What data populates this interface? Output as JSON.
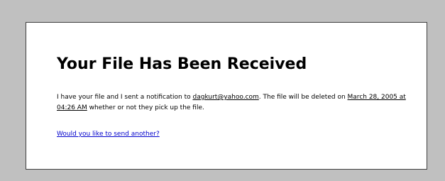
{
  "page": {
    "title": "Your File Has Been Received",
    "message": {
      "part1": "I have your file and I sent a notification to ",
      "email": "dagkurt@yahoo.com",
      "part2": ". The file will be deleted on ",
      "deletion_time": "March 28, 2005 at 04:26 AM",
      "part3": " whether or not they pick up the file."
    },
    "send_another_link": "Would you like to send another?"
  },
  "colors": {
    "background": "#c0c0c0",
    "card": "#ffffff",
    "link": "#0000cc"
  }
}
